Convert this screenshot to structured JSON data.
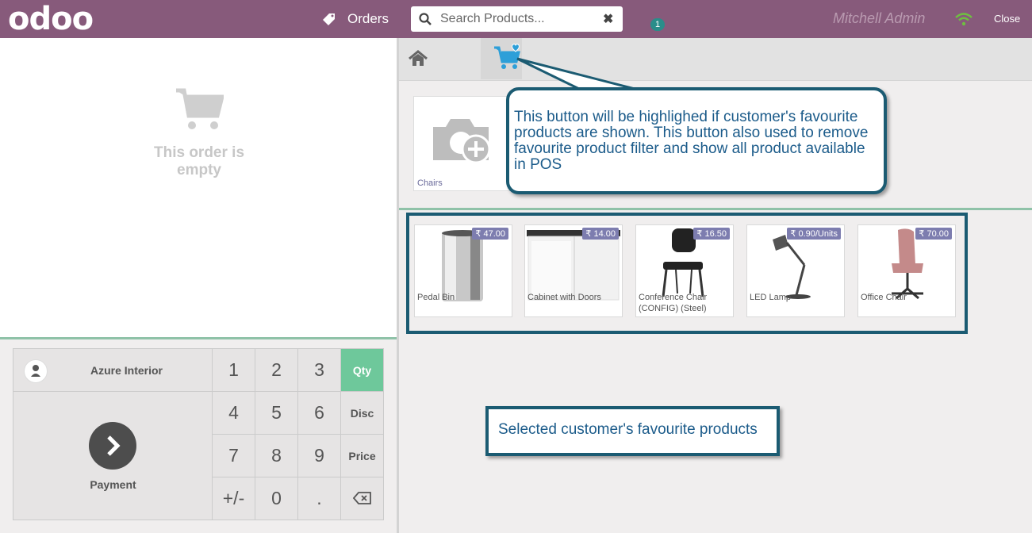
{
  "header": {
    "logo": "odoo",
    "orders_label": "Orders",
    "orders_count": "1",
    "search_placeholder": "Search Products...",
    "user_name": "Mitchell Admin",
    "close_label": "Close"
  },
  "order": {
    "empty_text": "This order is empty"
  },
  "customer": {
    "name": "Azure Interior"
  },
  "payment": {
    "label": "Payment"
  },
  "numpad": {
    "keys": [
      "1",
      "2",
      "3",
      "4",
      "5",
      "6",
      "7",
      "8",
      "9",
      "+/-",
      "0",
      "."
    ],
    "modes": [
      "Qty",
      "Disc",
      "Price"
    ]
  },
  "categories": [
    {
      "name": "Chairs"
    }
  ],
  "products": [
    {
      "name": "Pedal Bin",
      "price": "₹ 47.00"
    },
    {
      "name": "Cabinet with Doors",
      "price": "₹ 14.00"
    },
    {
      "name": "Conference Chair (CONFIG) (Steel)",
      "price": "₹ 16.50"
    },
    {
      "name": "LED Lamp",
      "price": "₹ 0.90/Units"
    },
    {
      "name": "Office Chair",
      "price": "₹ 70.00"
    }
  ],
  "annotations": {
    "fav_button_note": "This button will be highlighed if customer's favourite products are shown. This button also used to remove favourite product filter and show all product available in POS",
    "fav_products_note": "Selected customer's favourite products"
  },
  "colors": {
    "topbar": "#875a7b",
    "accent_green": "#6ec89b",
    "annotation_border": "#1b5b72",
    "fav_icon": "#2d9fd8"
  }
}
